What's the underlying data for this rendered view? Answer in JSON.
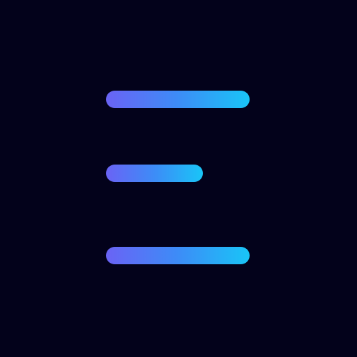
{
  "icon": {
    "name": "menu-lines-icon",
    "background_color": "#03021b",
    "gradient_start": "#6a63f5",
    "gradient_mid": "#3d8cf7",
    "gradient_end": "#19c5f7",
    "lines": [
      {
        "name": "line-top"
      },
      {
        "name": "line-middle"
      },
      {
        "name": "line-bottom"
      }
    ]
  }
}
